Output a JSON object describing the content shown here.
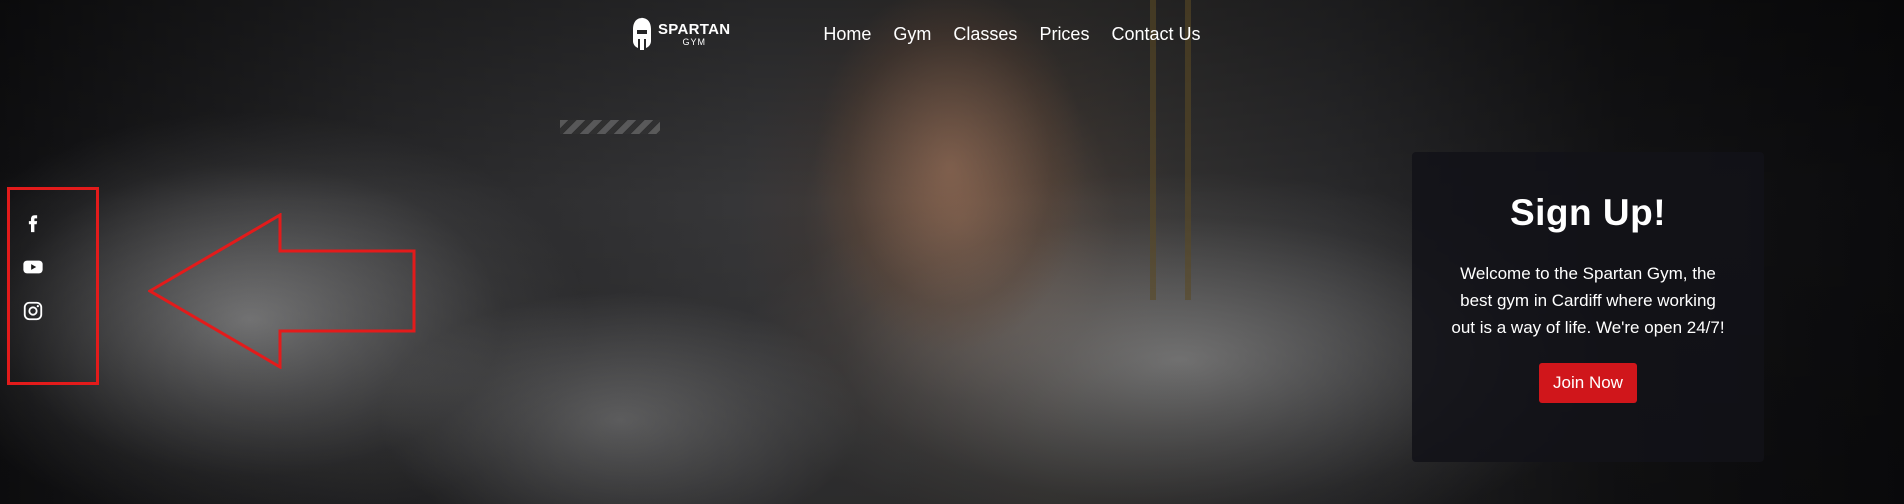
{
  "brand": {
    "name": "SPARTAN",
    "sub": "GYM",
    "icon": "spartan-helmet-icon"
  },
  "nav": {
    "items": [
      {
        "label": "Home"
      },
      {
        "label": "Gym"
      },
      {
        "label": "Classes"
      },
      {
        "label": "Prices"
      },
      {
        "label": "Contact Us"
      }
    ]
  },
  "social": {
    "icons": [
      "facebook-icon",
      "youtube-icon",
      "instagram-icon"
    ]
  },
  "signup": {
    "title": "Sign Up!",
    "text": "Welcome to the Spartan Gym, the best gym in Cardiff where working out is a way of life. We're open 24/7!",
    "button_label": "Join Now",
    "button_color": "#d0161b"
  },
  "annotation": {
    "color": "#e31b1b"
  }
}
